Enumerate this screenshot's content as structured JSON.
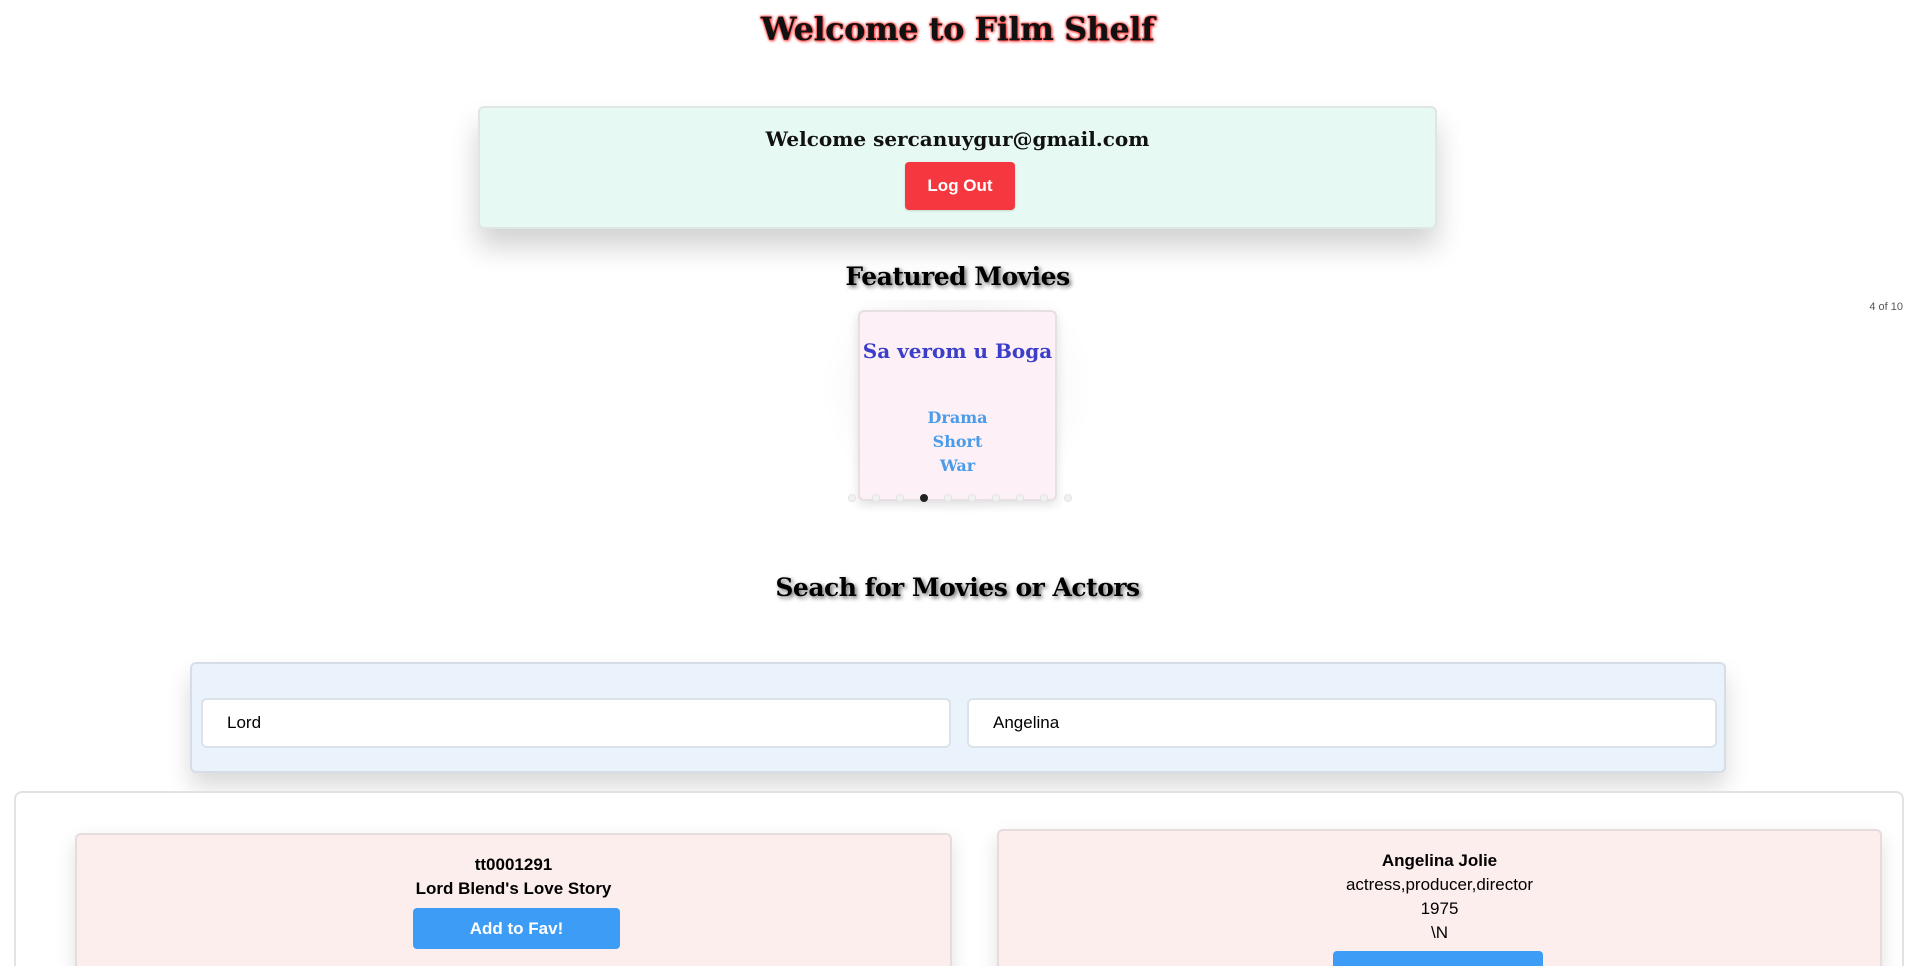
{
  "header": {
    "title": "Welcome to Film Shelf"
  },
  "welcome": {
    "text": "Welcome sercanuygur@gmail.com",
    "logout_label": "Log Out"
  },
  "featured": {
    "heading": "Featured Movies",
    "counter": "4 of 10",
    "current_index": 4,
    "total": 10,
    "card": {
      "title": "Sa verom u Boga",
      "genres": [
        "Drama",
        "Short",
        "War"
      ]
    }
  },
  "search": {
    "heading": "Seach for Movies or Actors",
    "movie_query": "Lord",
    "actor_query": "Angelina"
  },
  "results": {
    "movie": {
      "id": "tt0001291",
      "title": "Lord Blend's Love Story",
      "fav_label": "Add to Fav!"
    },
    "actor": {
      "name": "Angelina Jolie",
      "professions": "actress,producer,director",
      "birth_year": "1975",
      "death_year": "\\N",
      "fav_label": ""
    }
  },
  "colors": {
    "logout": "#f5383f",
    "fav": "#3d9cf5",
    "movie_title": "#3a3ec9",
    "genre": "#4a9bea",
    "welcome_bg": "#e6faf3",
    "search_bg": "#eaf3fc",
    "result_bg": "#fdeeee"
  }
}
